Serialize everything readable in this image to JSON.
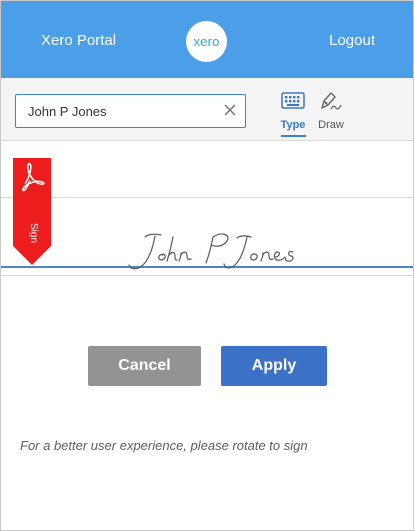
{
  "header": {
    "portal_title": "Xero Portal",
    "logo_text": "xero",
    "logout_label": "Logout",
    "bg_color": "#4a9fe8"
  },
  "toolbar": {
    "name_input": {
      "value": "John P Jones",
      "placeholder": ""
    },
    "clear_icon": "close-icon",
    "modes": [
      {
        "label": "Type",
        "icon": "keyboard-icon",
        "selected": true
      },
      {
        "label": "Draw",
        "icon": "pen-icon",
        "selected": false
      }
    ]
  },
  "signature": {
    "text": "John P Jones",
    "ribbon_label": "Sign",
    "ribbon_icon": "adobe-acrobat-icon",
    "ribbon_color": "#ee1d1d"
  },
  "actions": {
    "cancel_label": "Cancel",
    "apply_label": "Apply",
    "apply_color": "#3b72c6",
    "cancel_color": "#939393"
  },
  "hint": "For a better user experience, please rotate to sign"
}
